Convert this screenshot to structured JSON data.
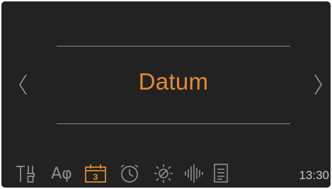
{
  "screen": {
    "title": "Datum",
    "prev_icon": "chevron-left-icon",
    "next_icon": "chevron-right-icon"
  },
  "statusbar": {
    "time": "13:30",
    "language_label": "Aφ",
    "calendar_day": "3",
    "icons": [
      "tools-icon",
      "language-icon",
      "calendar-icon",
      "clock-icon",
      "brightness-icon",
      "sound-icon",
      "document-icon"
    ],
    "active_icon": "calendar-icon"
  },
  "colors": {
    "accent": "#e48a34",
    "icon_inactive": "#8f8f8f",
    "background": "#222222",
    "rule": "#8a8a8a"
  }
}
